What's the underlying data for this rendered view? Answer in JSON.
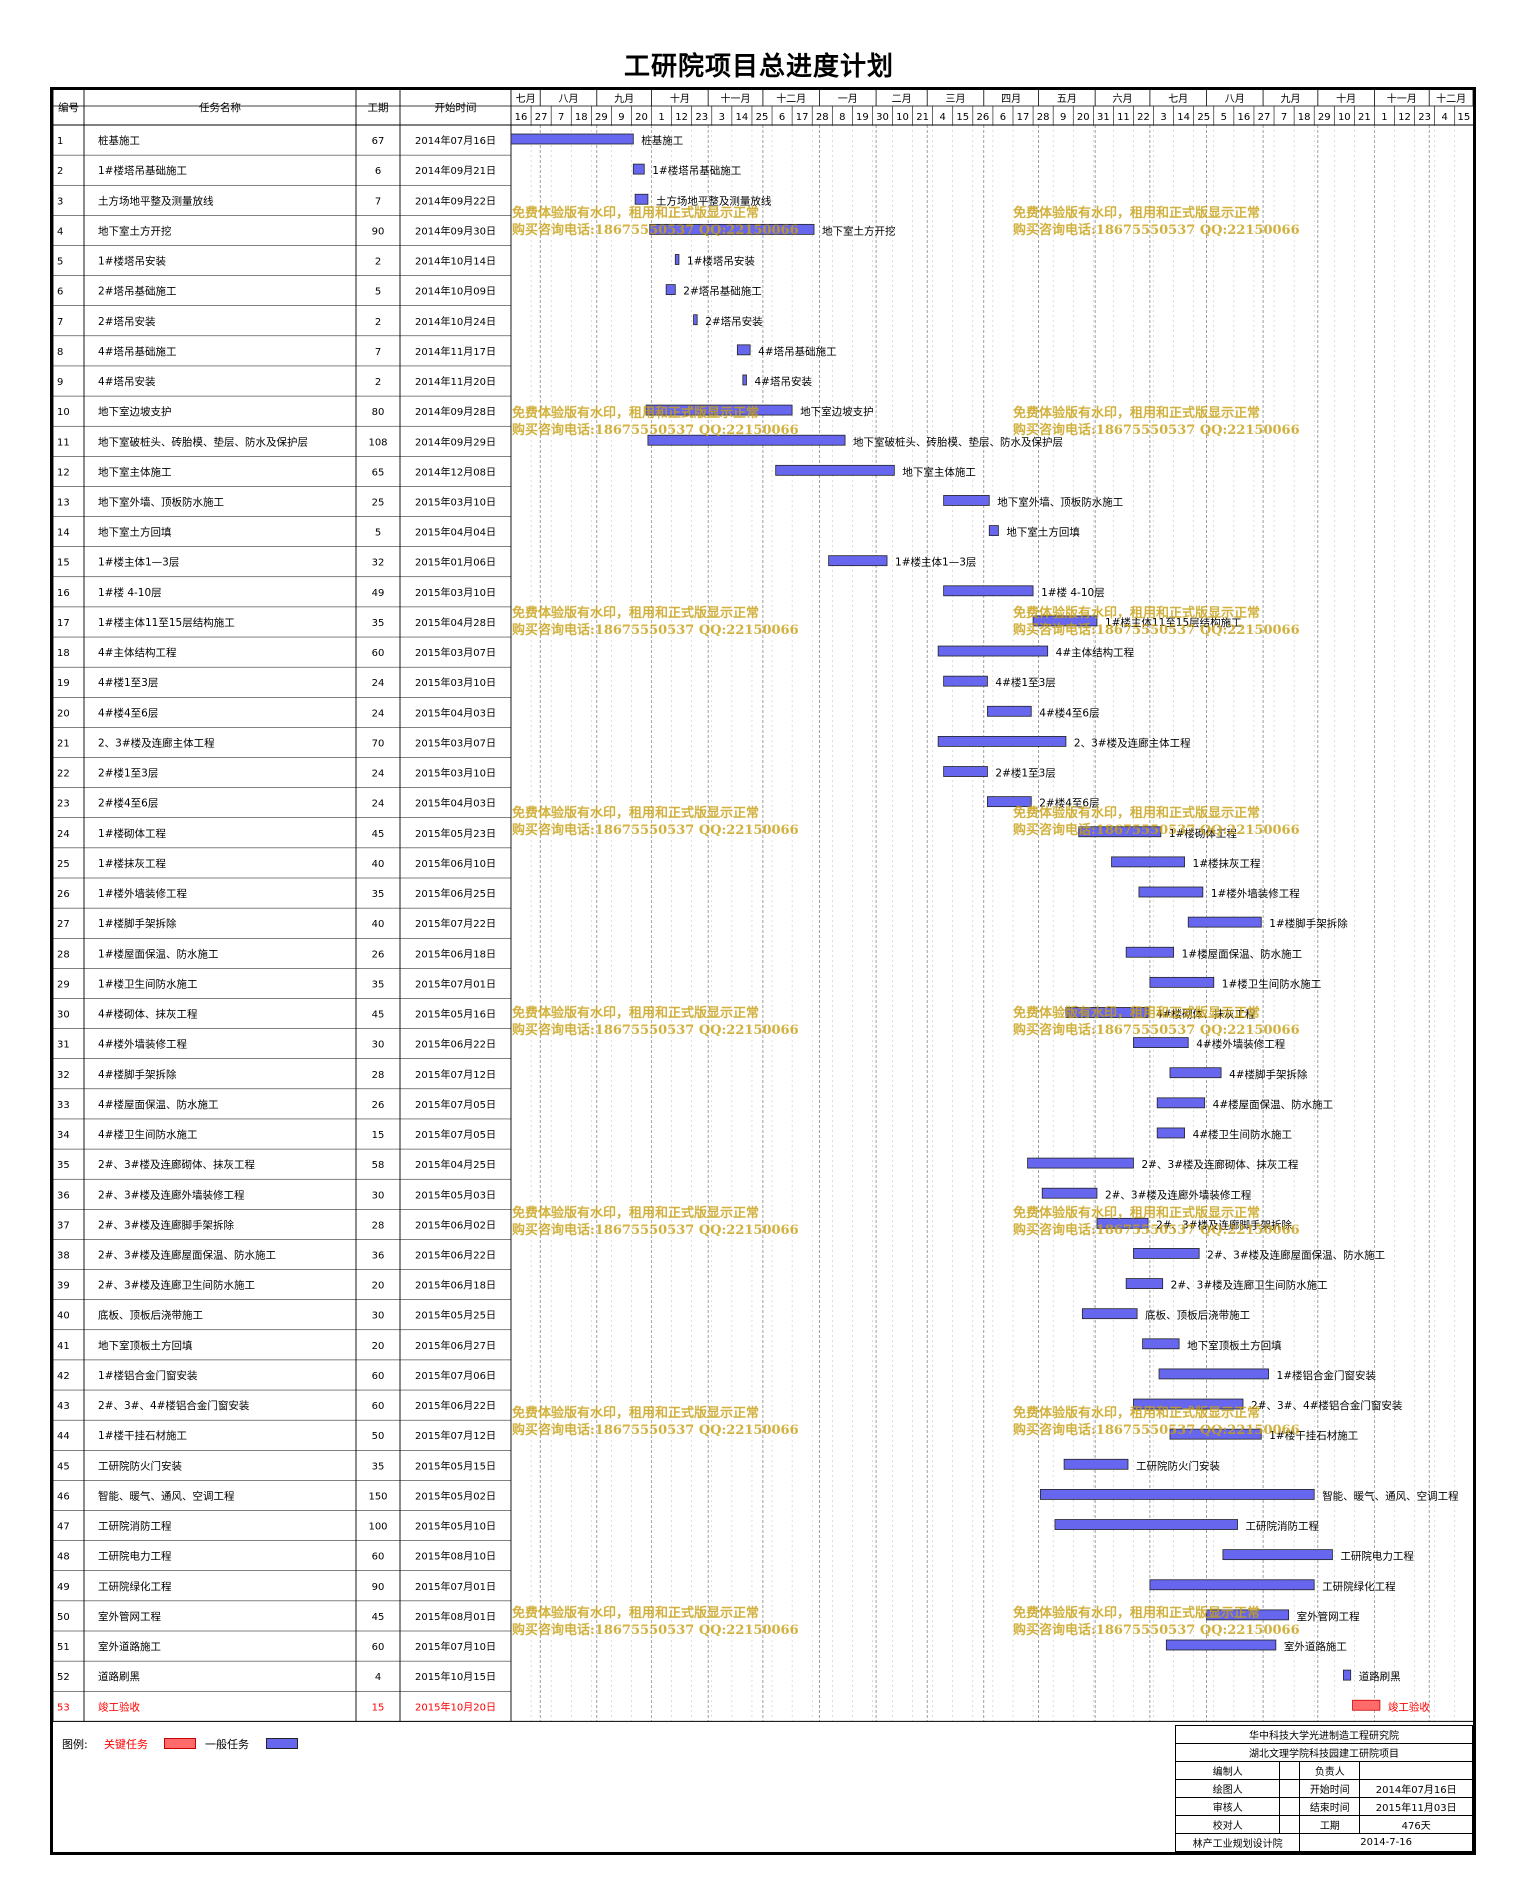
{
  "title": "工研院项目总进度计划",
  "headers": {
    "id": "编号",
    "name": "任务名称",
    "duration": "工期",
    "start": "开始时间"
  },
  "months": [
    "七月",
    "八月",
    "九月",
    "十月",
    "十一月",
    "十二月",
    "一月",
    "二月",
    "三月",
    "四月",
    "五月",
    "六月",
    "七月",
    "八月",
    "九月",
    "十月",
    "十一月",
    "十二月"
  ],
  "day_ticks": [
    "16",
    "27",
    "7",
    "18",
    "29",
    "9",
    "20",
    "1",
    "12",
    "23",
    "3",
    "14",
    "25",
    "6",
    "17",
    "28",
    "8",
    "19",
    "30",
    "10",
    "21",
    "4",
    "15",
    "26",
    "6",
    "17",
    "28",
    "9",
    "20",
    "31",
    "11",
    "22",
    "3",
    "14",
    "25",
    "5",
    "16",
    "27",
    "7",
    "18",
    "29",
    "10",
    "21",
    "1",
    "12",
    "23",
    "4",
    "15"
  ],
  "watermark": {
    "line1": "免费体验版有水印，租用和正式版显示正常",
    "line2": "购买咨询电话:18675550537 QQ:22150066"
  },
  "legend": {
    "label": "图例:",
    "critical": "关键任务",
    "normal": "一般任务",
    "critical_color": "#ff5a5a",
    "normal_color": "#6666ee"
  },
  "info_box": {
    "org1": "华中科技大学光进制造工程研究院",
    "org2": "湖北文理学院科技园建工研院项目",
    "r1_l": "编制人",
    "r1_m": "",
    "r1_k": "负责人",
    "r1_v": "",
    "r2_l": "绘图人",
    "r2_m": "",
    "r2_k": "开始时间",
    "r2_v": "2014年07月16日",
    "r3_l": "审核人",
    "r3_m": "",
    "r3_k": "结束时间",
    "r3_v": "2015年11月03日",
    "r4_l": "校对人",
    "r4_m": "",
    "r4_k": "工期",
    "r4_v": "476天",
    "footer_l": "林产工业规划设计院",
    "footer_r": "2014-7-16"
  },
  "chart_data": {
    "type": "gantt",
    "title": "工研院项目总进度计划",
    "time_range": [
      "2014-07-16",
      "2015-12-25"
    ],
    "tasks": [
      {
        "id": "1",
        "name": "桩基施工",
        "duration": 67,
        "start": "2014年07月16日",
        "critical": false
      },
      {
        "id": "2",
        "name": "1#楼塔吊基础施工",
        "duration": 6,
        "start": "2014年09月21日",
        "critical": false
      },
      {
        "id": "3",
        "name": "土方场地平整及测量放线",
        "duration": 7,
        "start": "2014年09月22日",
        "critical": false
      },
      {
        "id": "4",
        "name": "地下室土方开挖",
        "duration": 90,
        "start": "2014年09月30日",
        "critical": false
      },
      {
        "id": "5",
        "name": "1#楼塔吊安装",
        "duration": 2,
        "start": "2014年10月14日",
        "critical": false
      },
      {
        "id": "6",
        "name": "2#塔吊基础施工",
        "duration": 5,
        "start": "2014年10月09日",
        "critical": false
      },
      {
        "id": "7",
        "name": "2#塔吊安装",
        "duration": 2,
        "start": "2014年10月24日",
        "critical": false
      },
      {
        "id": "8",
        "name": "4#塔吊基础施工",
        "duration": 7,
        "start": "2014年11月17日",
        "critical": false
      },
      {
        "id": "9",
        "name": "4#塔吊安装",
        "duration": 2,
        "start": "2014年11月20日",
        "critical": false
      },
      {
        "id": "10",
        "name": "地下室边坡支护",
        "duration": 80,
        "start": "2014年09月28日",
        "critical": false
      },
      {
        "id": "11",
        "name": "地下室破桩头、砖胎模、垫层、防水及保护层",
        "duration": 108,
        "start": "2014年09月29日",
        "critical": false
      },
      {
        "id": "12",
        "name": "地下室主体施工",
        "duration": 65,
        "start": "2014年12月08日",
        "critical": false
      },
      {
        "id": "13",
        "name": "地下室外墙、顶板防水施工",
        "duration": 25,
        "start": "2015年03月10日",
        "critical": false
      },
      {
        "id": "14",
        "name": "地下室土方回填",
        "duration": 5,
        "start": "2015年04月04日",
        "critical": false
      },
      {
        "id": "15",
        "name": "1#楼主体1—3层",
        "duration": 32,
        "start": "2015年01月06日",
        "critical": false
      },
      {
        "id": "16",
        "name": "1#楼 4-10层",
        "duration": 49,
        "start": "2015年03月10日",
        "critical": false
      },
      {
        "id": "17",
        "name": "1#楼主体11至15层结构施工",
        "duration": 35,
        "start": "2015年04月28日",
        "critical": false
      },
      {
        "id": "18",
        "name": "4#主体结构工程",
        "duration": 60,
        "start": "2015年03月07日",
        "critical": false
      },
      {
        "id": "19",
        "name": "4#楼1至3层",
        "duration": 24,
        "start": "2015年03月10日",
        "critical": false
      },
      {
        "id": "20",
        "name": "4#楼4至6层",
        "duration": 24,
        "start": "2015年04月03日",
        "critical": false
      },
      {
        "id": "21",
        "name": "2、3#楼及连廊主体工程",
        "duration": 70,
        "start": "2015年03月07日",
        "critical": false
      },
      {
        "id": "22",
        "name": "2#楼1至3层",
        "duration": 24,
        "start": "2015年03月10日",
        "critical": false
      },
      {
        "id": "23",
        "name": "2#楼4至6层",
        "duration": 24,
        "start": "2015年04月03日",
        "critical": false
      },
      {
        "id": "24",
        "name": "1#楼砌体工程",
        "duration": 45,
        "start": "2015年05月23日",
        "critical": false
      },
      {
        "id": "25",
        "name": "1#楼抹灰工程",
        "duration": 40,
        "start": "2015年06月10日",
        "critical": false
      },
      {
        "id": "26",
        "name": "1#楼外墙装修工程",
        "duration": 35,
        "start": "2015年06月25日",
        "critical": false
      },
      {
        "id": "27",
        "name": "1#楼脚手架拆除",
        "duration": 40,
        "start": "2015年07月22日",
        "critical": false
      },
      {
        "id": "28",
        "name": "1#楼屋面保温、防水施工",
        "duration": 26,
        "start": "2015年06月18日",
        "critical": false
      },
      {
        "id": "29",
        "name": "1#楼卫生间防水施工",
        "duration": 35,
        "start": "2015年07月01日",
        "critical": false
      },
      {
        "id": "30",
        "name": "4#楼砌体、抹灰工程",
        "duration": 45,
        "start": "2015年05月16日",
        "critical": false
      },
      {
        "id": "31",
        "name": "4#楼外墙装修工程",
        "duration": 30,
        "start": "2015年06月22日",
        "critical": false
      },
      {
        "id": "32",
        "name": "4#楼脚手架拆除",
        "duration": 28,
        "start": "2015年07月12日",
        "critical": false
      },
      {
        "id": "33",
        "name": "4#楼屋面保温、防水施工",
        "duration": 26,
        "start": "2015年07月05日",
        "critical": false
      },
      {
        "id": "34",
        "name": "4#楼卫生间防水施工",
        "duration": 15,
        "start": "2015年07月05日",
        "critical": false
      },
      {
        "id": "35",
        "name": "2#、3#楼及连廊砌体、抹灰工程",
        "duration": 58,
        "start": "2015年04月25日",
        "critical": false
      },
      {
        "id": "36",
        "name": "2#、3#楼及连廊外墙装修工程",
        "duration": 30,
        "start": "2015年05月03日",
        "critical": false
      },
      {
        "id": "37",
        "name": "2#、3#楼及连廊脚手架拆除",
        "duration": 28,
        "start": "2015年06月02日",
        "critical": false
      },
      {
        "id": "38",
        "name": "2#、3#楼及连廊屋面保温、防水施工",
        "duration": 36,
        "start": "2015年06月22日",
        "critical": false
      },
      {
        "id": "39",
        "name": "2#、3#楼及连廊卫生间防水施工",
        "duration": 20,
        "start": "2015年06月18日",
        "critical": false
      },
      {
        "id": "40",
        "name": "底板、顶板后浇带施工",
        "duration": 30,
        "start": "2015年05月25日",
        "critical": false
      },
      {
        "id": "41",
        "name": "地下室顶板土方回填",
        "duration": 20,
        "start": "2015年06月27日",
        "critical": false
      },
      {
        "id": "42",
        "name": "1#楼铝合金门窗安装",
        "duration": 60,
        "start": "2015年07月06日",
        "critical": false
      },
      {
        "id": "43",
        "name": "2#、3#、4#楼铝合金门窗安装",
        "duration": 60,
        "start": "2015年06月22日",
        "critical": false
      },
      {
        "id": "44",
        "name": "1#楼干挂石材施工",
        "duration": 50,
        "start": "2015年07月12日",
        "critical": false
      },
      {
        "id": "45",
        "name": "工研院防火门安装",
        "duration": 35,
        "start": "2015年05月15日",
        "critical": false
      },
      {
        "id": "46",
        "name": "智能、暖气、通风、空调工程",
        "duration": 150,
        "start": "2015年05月02日",
        "critical": false
      },
      {
        "id": "47",
        "name": "工研院消防工程",
        "duration": 100,
        "start": "2015年05月10日",
        "critical": false
      },
      {
        "id": "48",
        "name": "工研院电力工程",
        "duration": 60,
        "start": "2015年08月10日",
        "critical": false
      },
      {
        "id": "49",
        "name": "工研院绿化工程",
        "duration": 90,
        "start": "2015年07月01日",
        "critical": false
      },
      {
        "id": "50",
        "name": "室外管网工程",
        "duration": 45,
        "start": "2015年08月01日",
        "critical": false
      },
      {
        "id": "51",
        "name": "室外道路施工",
        "duration": 60,
        "start": "2015年07月10日",
        "critical": false
      },
      {
        "id": "52",
        "name": "道路刷黑",
        "duration": 4,
        "start": "2015年10月15日",
        "critical": false
      },
      {
        "id": "53",
        "name": "竣工验收",
        "duration": 15,
        "start": "2015年10月20日",
        "critical": true
      }
    ]
  }
}
